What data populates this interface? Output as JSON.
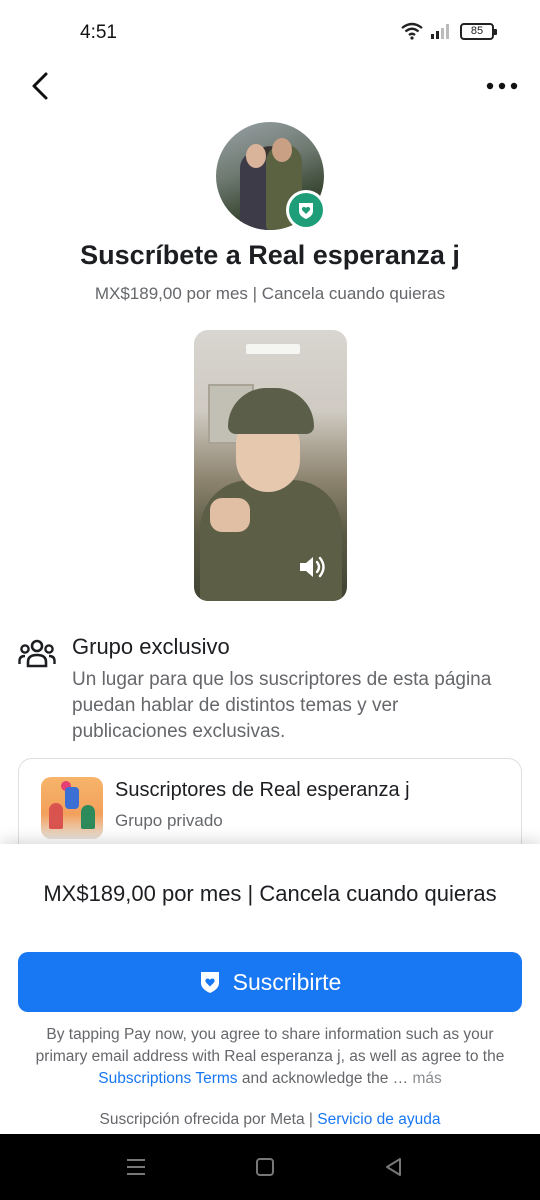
{
  "status_bar": {
    "time": "4:51",
    "battery": "85"
  },
  "nav": {
    "back_icon": "chevron-left-icon",
    "more_icon": "more-dots-icon"
  },
  "header": {
    "title": "Suscríbete a Real esperanza j",
    "subtitle": "MX$189,00 por mes | Cancela cuando quieras"
  },
  "group": {
    "title": "Grupo exclusivo",
    "description": "Un lugar para que los suscriptores de esta página puedan hablar de distintos temas y ver publicaciones exclusivas.",
    "card": {
      "name": "Suscriptores de Real esperanza j",
      "privacy": "Grupo privado"
    }
  },
  "bottom_sheet": {
    "price": "MX$189,00 por mes | Cancela cuando quieras",
    "subscribe_label": "Suscribirte",
    "legal_before": "By tapping Pay now, you agree to share information such as your primary email address with Real esperanza j, as well as agree to the ",
    "legal_link": "Subscriptions Terms",
    "legal_after": " and acknowledge the … ",
    "legal_more": "más",
    "footer_text": "Suscripción ofrecida por Meta | ",
    "footer_link": "Servicio de ayuda"
  },
  "colors": {
    "accent": "#1877f2",
    "badge": "#1e9e78",
    "text": "#1c1e21",
    "secondary": "#65676b"
  }
}
